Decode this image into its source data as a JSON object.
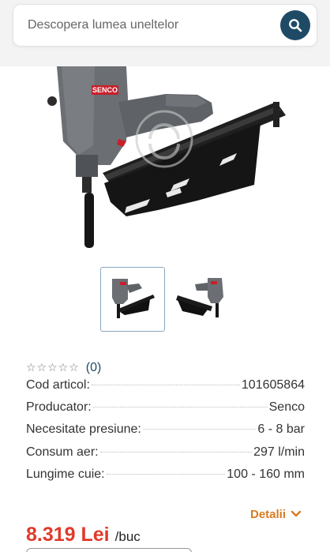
{
  "search": {
    "placeholder": "Descopera lumea uneltelor"
  },
  "product": {
    "brand": "SENCO",
    "images": [
      {
        "icon": "nailer-thumbnail-icon",
        "selected": true
      },
      {
        "icon": "nailer-thumbnail-alt-icon",
        "selected": false
      }
    ],
    "rating": {
      "stars": "☆☆☆☆☆",
      "count": "(0)",
      "value": 0,
      "max": 5
    },
    "specs": [
      {
        "label": "Cod articol:",
        "value": "101605864"
      },
      {
        "label": "Producator:",
        "value": "Senco"
      },
      {
        "label": "Necesitate presiune:",
        "value": "6 - 8 bar"
      },
      {
        "label": "Consum aer:",
        "value": "297 l/min"
      },
      {
        "label": "Lungime cuie:",
        "value": "100 - 160 mm"
      }
    ],
    "details_label": "Detalii",
    "price": "8.319 Lei",
    "unit": "/buc"
  },
  "colors": {
    "accent": "#1e4a66",
    "link": "#d97b22",
    "price": "#e03a2a"
  }
}
